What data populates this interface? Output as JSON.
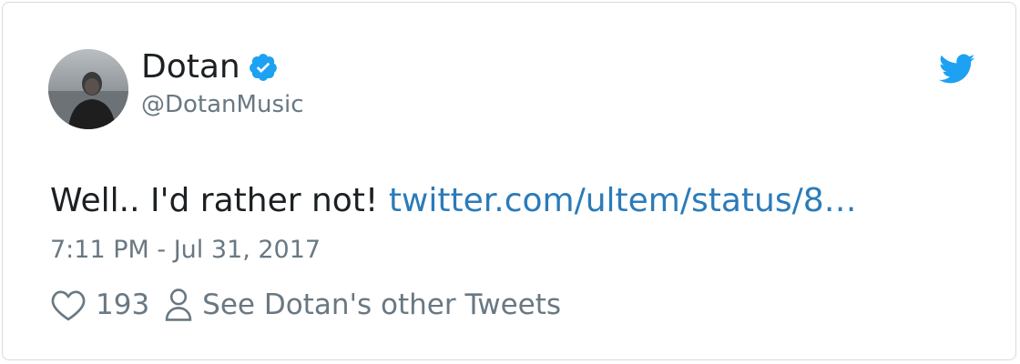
{
  "user": {
    "display_name": "Dotan",
    "handle": "@DotanMusic",
    "verified": true,
    "avatar_icon": "profile-photo"
  },
  "tweet": {
    "text": "Well.. I'd rather not!",
    "link_text": "twitter.com/ultem/status/8…",
    "timestamp": "7:11 PM - Jul 31, 2017"
  },
  "actions": {
    "like_count": "193",
    "other_tweets_label": "See Dotan's other Tweets"
  },
  "icons": {
    "brand": "twitter-bird-icon",
    "verified": "verified-badge-icon",
    "like": "heart-icon",
    "profile": "person-icon"
  },
  "colors": {
    "twitter_blue": "#1da1f2",
    "link_blue": "#2b7bb9",
    "text_primary": "#1c2022",
    "text_secondary": "#697882"
  }
}
